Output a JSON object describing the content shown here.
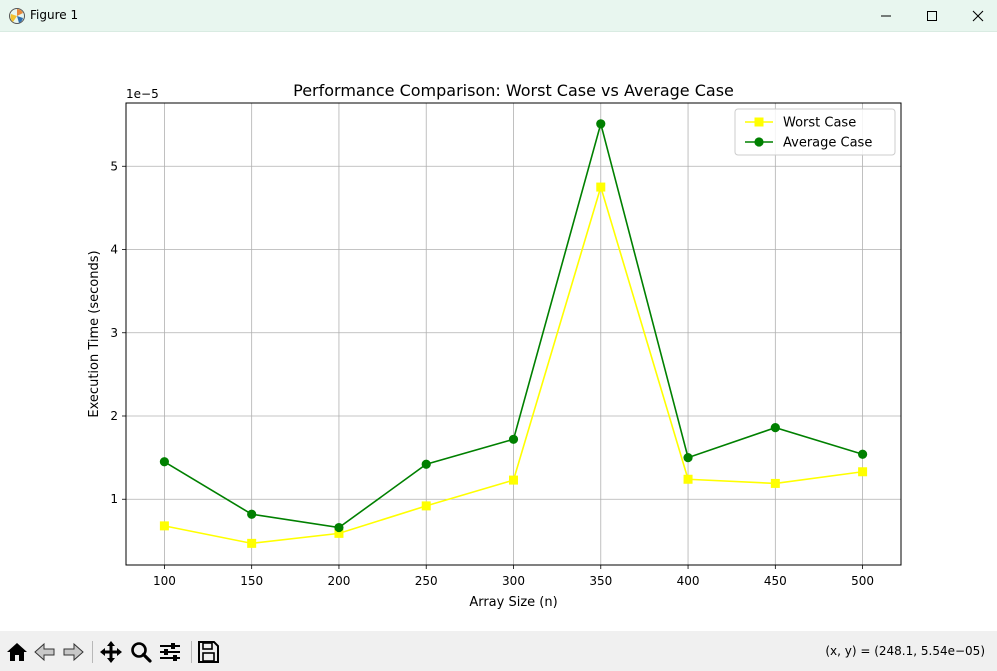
{
  "window": {
    "title": "Figure 1",
    "icon": "matplotlib-logo-icon",
    "controls": [
      "minimize-icon",
      "maximize-icon",
      "close-icon"
    ]
  },
  "toolbar": {
    "tools": [
      "home-icon",
      "back-arrow-icon",
      "forward-arrow-icon",
      "pan-icon",
      "zoom-icon",
      "configure-subplots-icon",
      "save-icon"
    ],
    "coords_text": "(x, y) = (248.1, 5.54e−05)"
  },
  "chart_data": {
    "type": "line",
    "title": "Performance Comparison: Worst Case vs Average Case",
    "xlabel": "Array Size (n)",
    "ylabel": "Execution Time (seconds)",
    "y_offset_label": "1e−5",
    "x": [
      100,
      150,
      200,
      250,
      300,
      350,
      400,
      450,
      500
    ],
    "xlim": [
      78,
      522
    ],
    "ylim": [
      0.21,
      5.76
    ],
    "xticks": [
      100,
      150,
      200,
      250,
      300,
      350,
      400,
      450,
      500
    ],
    "yticks": [
      1,
      2,
      3,
      4,
      5
    ],
    "grid": true,
    "legend_position": "upper right",
    "series": [
      {
        "name": "Worst Case",
        "color": "#ffff00",
        "marker": "square",
        "values": [
          0.68,
          0.47,
          0.59,
          0.92,
          1.23,
          4.75,
          1.24,
          1.19,
          1.33
        ]
      },
      {
        "name": "Average Case",
        "color": "#008000",
        "marker": "circle",
        "values": [
          1.45,
          0.82,
          0.66,
          1.42,
          1.72,
          5.51,
          1.5,
          1.86,
          1.54
        ]
      }
    ]
  }
}
